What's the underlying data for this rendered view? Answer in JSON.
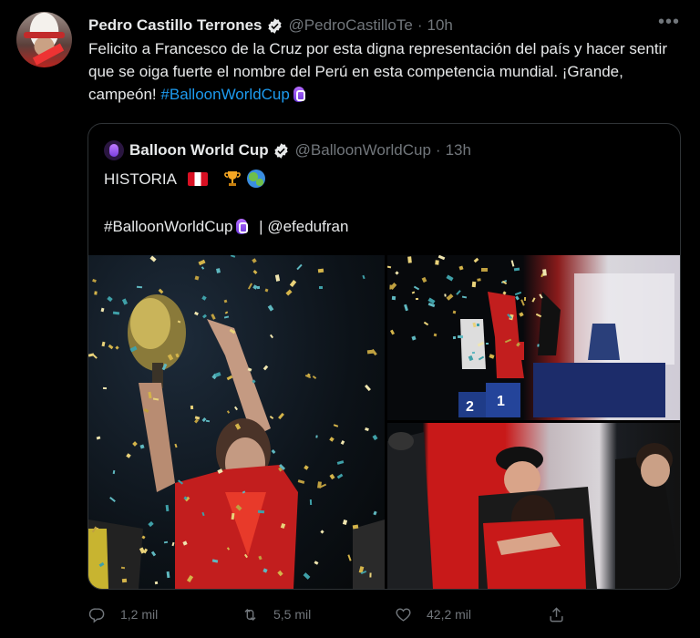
{
  "tweet": {
    "author_name": "Pedro Castillo Terrones",
    "author_handle": "@PedroCastilloTe",
    "separator": "·",
    "time": "10h",
    "more_label": "•••",
    "text_before_hashtag": "Felicito a Francesco de la Cruz por esta digna representación del país y hacer sentir que se oiga fuerte el nombre del Perú en esta competencia mundial. ¡Grande, campeón!",
    "hashtag": "#BalloonWorldCup"
  },
  "quoted_tweet": {
    "author_name": "Balloon World Cup",
    "author_handle": "@BalloonWorldCup",
    "separator": "·",
    "time": "13h",
    "line1": "HISTORIA",
    "hashtag": "#BalloonWorldCup",
    "mention_sep": "|",
    "mention": "@efedufran"
  },
  "actions": {
    "replies": "1,2 mil",
    "retweets": "5,5 mil",
    "likes": "42,2 mil"
  },
  "icons": {
    "verified": "verified-badge-icon",
    "reply": "reply-icon",
    "retweet": "retweet-icon",
    "like": "heart-icon",
    "share": "share-icon"
  },
  "colors": {
    "background": "#000000",
    "text": "#e7e9ea",
    "muted": "#71767b",
    "link": "#1d9bf0",
    "border": "#2f3336"
  }
}
